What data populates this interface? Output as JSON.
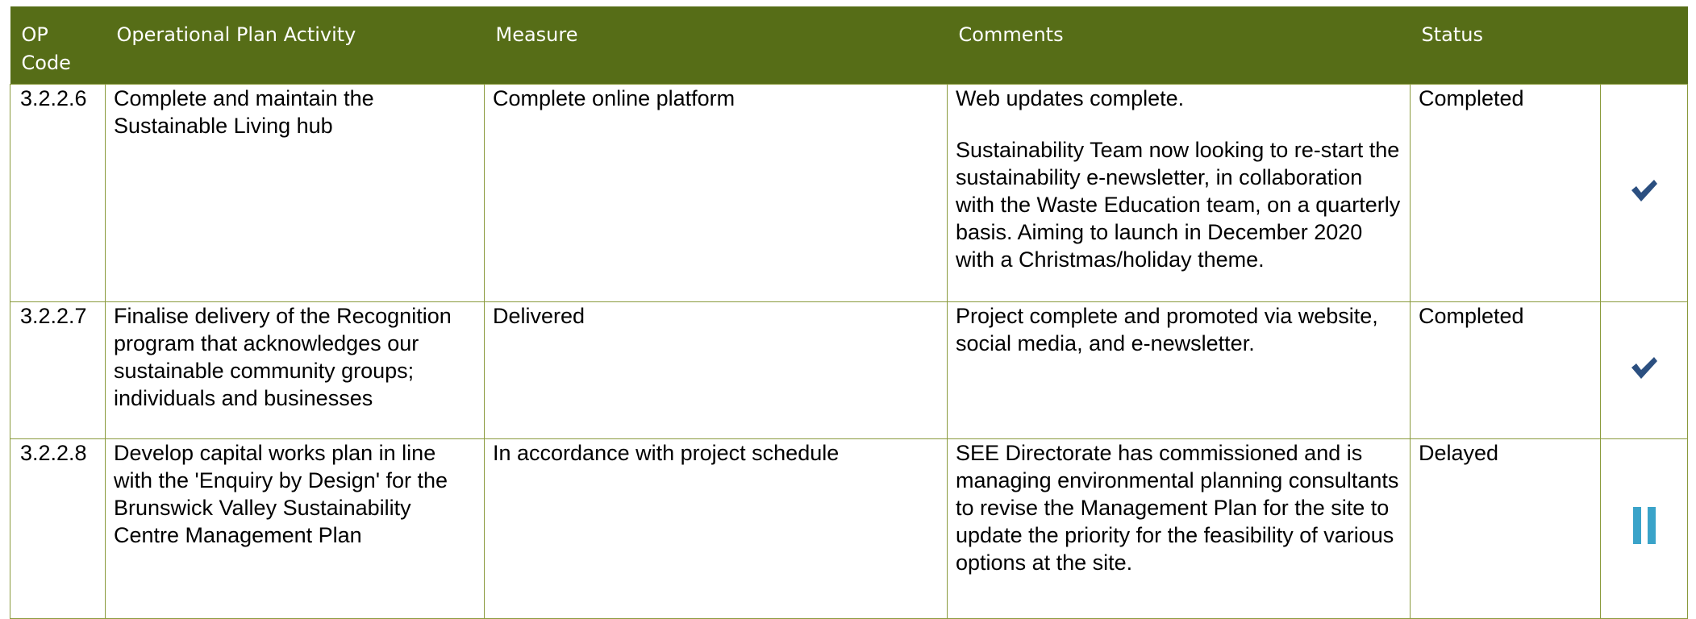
{
  "header": {
    "op_code": "OP Code",
    "activity": "Operational Plan Activity",
    "measure": "Measure",
    "comments": "Comments",
    "status": "Status"
  },
  "rows": [
    {
      "code": "3.2.2.6",
      "activity": "Complete and maintain the Sustainable Living hub",
      "measure": "Complete online platform",
      "comments": [
        "Web updates complete.",
        "Sustainability Team now looking to re-start the sustainability e-newsletter, in collaboration with the Waste Education team, on a quarterly basis. Aiming to launch in December 2020 with a Christmas/holiday theme."
      ],
      "status": "Completed",
      "status_icon": "check-icon"
    },
    {
      "code": "3.2.2.7",
      "activity": "Finalise delivery of the Recognition program that acknowledges our sustainable community groups; individuals and businesses",
      "measure": "Delivered",
      "comments": [
        "Project complete and promoted via website, social media, and e-newsletter."
      ],
      "status": "Completed",
      "status_icon": "check-icon"
    },
    {
      "code": "3.2.2.8",
      "activity": "Develop capital works plan in line with the 'Enquiry by Design' for the Brunswick Valley Sustainability Centre Management Plan",
      "measure": "In accordance with project schedule",
      "comments": [
        "SEE Directorate has commissioned and is managing environmental planning consultants to revise the Management Plan for the site to update the priority for the feasibility of various options at the site."
      ],
      "status": "Delayed",
      "status_icon": "pause-icon"
    }
  ],
  "colors": {
    "header_bg": "#566d17",
    "border": "#8a9a3c",
    "check": "#2b4f80",
    "pause": "#3aa3c9"
  }
}
